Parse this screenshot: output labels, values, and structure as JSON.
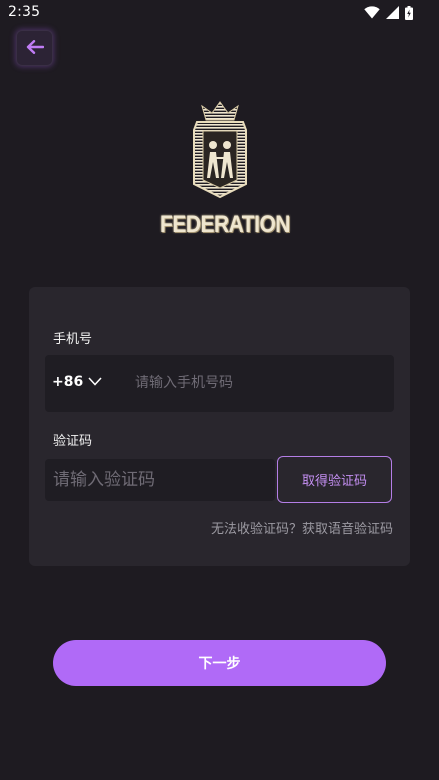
{
  "status_bar": {
    "time": "2:35",
    "icons": [
      "wifi-icon",
      "cell-signal-icon",
      "battery-charging-icon"
    ]
  },
  "header": {
    "back_icon": "arrow-left-icon"
  },
  "logo": {
    "brand_text": "FEDERATION",
    "emblem": "crowned-shield-emblem"
  },
  "form": {
    "phone_label": "手机号",
    "country_code": "+86",
    "country_code_icon": "chevron-down-icon",
    "phone_placeholder": "请输入手机号码",
    "code_label": "验证码",
    "code_placeholder": "请输入验证码",
    "get_code_button": "取得验证码",
    "voice_code_link": "无法收验证码？获取语音验证码"
  },
  "actions": {
    "next_button": "下一步"
  },
  "colors": {
    "background": "#1e1b21",
    "card": "#29262d",
    "input": "#1f1d23",
    "accent": "#b06af7",
    "accent_text": "#c48ff2",
    "muted_text": "#9c9aa2"
  }
}
